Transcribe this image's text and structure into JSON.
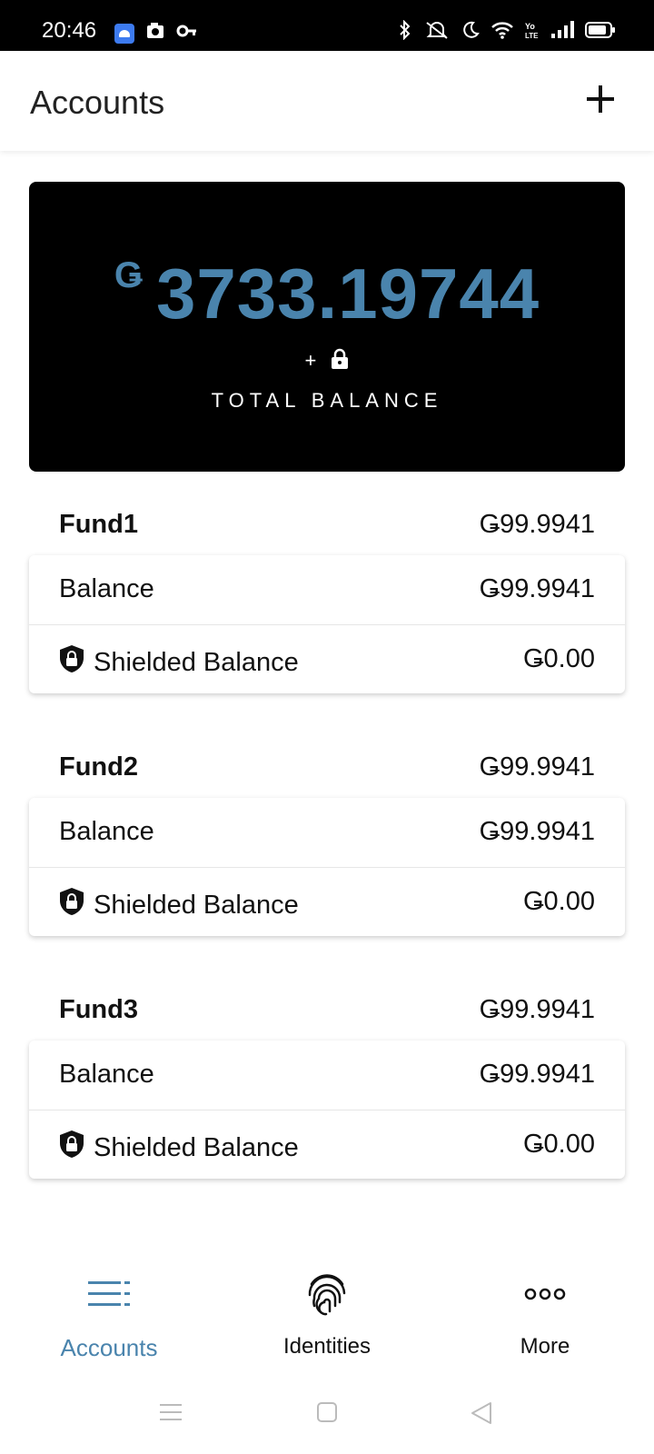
{
  "status_bar": {
    "time": "20:46",
    "left_icons": [
      "android-app-icon",
      "camera-icon",
      "key-icon"
    ],
    "right_icons": [
      "bluetooth-icon",
      "silent-icon",
      "moon-icon",
      "wifi-icon",
      "volte-icon",
      "signal-icon",
      "battery-icon"
    ]
  },
  "header": {
    "title": "Accounts",
    "add_icon": "plus-icon"
  },
  "total": {
    "currency_symbol": "Ǥ",
    "amount": "3733.19744",
    "lock_prefix": "+",
    "label": "TOTAL BALANCE",
    "accent_color": "#4a84ad"
  },
  "funds": [
    {
      "name": "Fund1",
      "total": "Ǥ99.9941",
      "balance_label": "Balance",
      "balance": "Ǥ99.9941",
      "shielded_label": "Shielded Balance",
      "shielded": "Ǥ0.00"
    },
    {
      "name": "Fund2",
      "total": "Ǥ99.9941",
      "balance_label": "Balance",
      "balance": "Ǥ99.9941",
      "shielded_label": "Shielded Balance",
      "shielded": "Ǥ0.00"
    },
    {
      "name": "Fund3",
      "total": "Ǥ99.9941",
      "balance_label": "Balance",
      "balance": "Ǥ99.9941",
      "shielded_label": "Shielded Balance",
      "shielded": "Ǥ0.00"
    }
  ],
  "bottom_nav": {
    "items": [
      {
        "label": "Accounts",
        "icon": "list-icon",
        "active": true
      },
      {
        "label": "Identities",
        "icon": "fingerprint-icon",
        "active": false
      },
      {
        "label": "More",
        "icon": "more-dots-icon",
        "active": false
      }
    ]
  },
  "system_nav": [
    "menu-icon",
    "home-square-icon",
    "back-triangle-icon"
  ]
}
